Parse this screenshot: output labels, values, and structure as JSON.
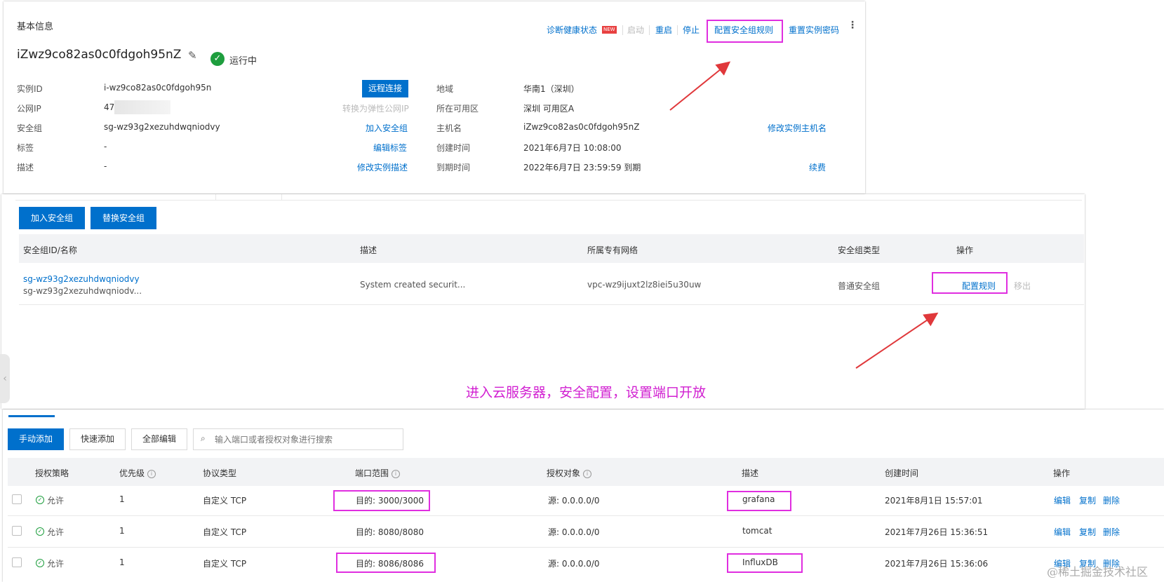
{
  "basic": {
    "section_title": "基本信息",
    "actions": {
      "diagnose": "诊断健康状态",
      "new_badge": "NEW",
      "start": "启动",
      "restart": "重启",
      "stop": "停止",
      "config_sg": "配置安全组规则",
      "reset_pwd": "重置实例密码"
    },
    "instance_name": "iZwz9co82as0c0fdgoh95nZ",
    "status": "运行中",
    "left": {
      "id_label": "实例ID",
      "id_value": "i-wz9co82as0c0fdgoh95n",
      "ip_label": "公网IP",
      "ip_value": "47",
      "sg_label": "安全组",
      "sg_value": "sg-wz93g2xezuhdwqniodvy",
      "tag_label": "标签",
      "tag_value": "-",
      "desc_label": "描述",
      "desc_value": "-"
    },
    "left_actions": {
      "remote": "远程连接",
      "convert_eip": "转换为弹性公网IP",
      "join_sg": "加入安全组",
      "edit_tags": "编辑标签",
      "edit_desc": "修改实例描述"
    },
    "right": {
      "region_label": "地域",
      "region_value": "华南1（深圳）",
      "zone_label": "所在可用区",
      "zone_value": "深圳 可用区A",
      "host_label": "主机名",
      "host_value": "iZwz9co82as0c0fdgoh95nZ",
      "created_label": "创建时间",
      "created_value": "2021年6月7日 10:08:00",
      "expire_label": "到期时间",
      "expire_value": "2022年6月7日 23:59:59 到期"
    },
    "right_actions": {
      "edit_host": "修改实例主机名",
      "renew": "续费"
    }
  },
  "sg_panel": {
    "join_btn": "加入安全组",
    "replace_btn": "替换安全组",
    "headers": [
      "安全组ID/名称",
      "描述",
      "所属专有网络",
      "安全组类型",
      "操作"
    ],
    "row": {
      "id": "sg-wz93g2xezuhdwqniodvy",
      "name": "sg-wz93g2xezuhdwqniodv...",
      "desc": "System created securit...",
      "vpc": "vpc-wz9ijuxt2lz8iei5u30uw",
      "type": "普通安全组",
      "config": "配置规则",
      "remove": "移出"
    },
    "annotation": "进入云服务器，安全配置，设置端口开放"
  },
  "rules_panel": {
    "manual_add": "手动添加",
    "quick_add": "快速添加",
    "edit_all": "全部编辑",
    "search_placeholder": "输入端口或者授权对象进行搜索",
    "headers": {
      "policy": "授权策略",
      "priority": "优先级",
      "protocol": "协议类型",
      "port": "端口范围",
      "object": "授权对象",
      "desc": "描述",
      "created": "创建时间",
      "ops": "操作"
    },
    "rows": [
      {
        "policy": "允许",
        "priority": "1",
        "protocol": "自定义 TCP",
        "port": "目的: 3000/3000",
        "object": "源: 0.0.0.0/0",
        "desc": "grafana",
        "created": "2021年8月1日 15:57:01",
        "edit": "编辑",
        "copy": "复制",
        "delete": "删除"
      },
      {
        "policy": "允许",
        "priority": "1",
        "protocol": "自定义 TCP",
        "port": "目的: 8080/8080",
        "object": "源: 0.0.0.0/0",
        "desc": "tomcat",
        "created": "2021年7月26日 15:36:51",
        "edit": "编辑",
        "copy": "复制",
        "delete": "删除"
      },
      {
        "policy": "允许",
        "priority": "1",
        "protocol": "自定义 TCP",
        "port": "目的: 8086/8086",
        "object": "源: 0.0.0.0/0",
        "desc": "InfluxDB",
        "created": "2021年7月26日 15:36:06",
        "edit": "编辑",
        "copy": "复制",
        "delete": "删除"
      }
    ]
  },
  "watermark": "@稀土掘金技术社区",
  "colors": {
    "link": "#0070cc",
    "highlight": "#e02ee0",
    "annotation": "#d11fd1",
    "arrow": "#e0383b",
    "primary": "#0070cc"
  }
}
